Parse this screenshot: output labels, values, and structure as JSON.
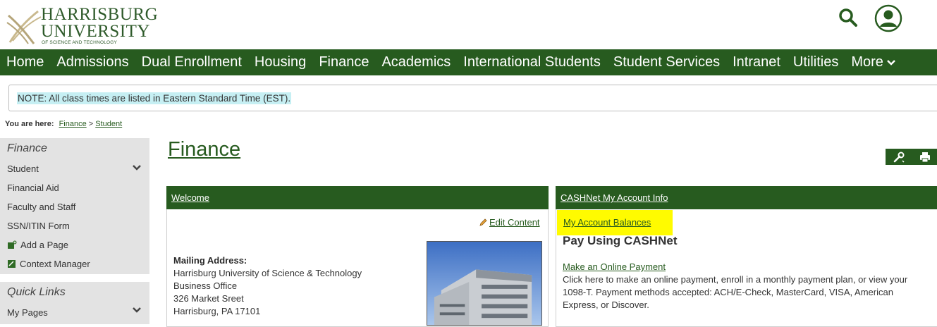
{
  "logo": {
    "line1": "HARRISBURG",
    "line2": "UNIVERSITY",
    "line3": "OF SCIENCE AND TECHNOLOGY"
  },
  "header": {
    "search_icon": "search-icon",
    "user_icon": "user-account-icon"
  },
  "nav": {
    "items": [
      "Home",
      "Admissions",
      "Dual Enrollment",
      "Housing",
      "Finance",
      "Academics",
      "International Students",
      "Student Services",
      "Intranet",
      "Utilities"
    ],
    "more_label": "More"
  },
  "note": {
    "text": "NOTE: All class times are listed in Eastern Standard Time (EST)."
  },
  "breadcrumb": {
    "label": "You are here:",
    "items": [
      "Finance",
      "Student"
    ],
    "separator": ">"
  },
  "sidebar": {
    "section1_title": "Finance",
    "items": [
      "Student",
      "Financial Aid",
      "Faculty and Staff",
      "SSN/ITIN Form"
    ],
    "add_page": "Add a Page",
    "context_manager": "Context Manager",
    "section2_title": "Quick Links",
    "section2_items": [
      "My Pages"
    ]
  },
  "main": {
    "title": "Finance"
  },
  "welcome_panel": {
    "title": "Welcome",
    "edit_label": "Edit Content",
    "address_heading": "Mailing Address:",
    "address_lines": [
      "Harrisburg University of Science & Technology",
      "Business Office",
      "326 Market Sreet",
      "Harrisburg, PA 17101"
    ]
  },
  "cashnet_panel": {
    "title": "CASHNet My Account Info",
    "balances_link": "My Account Balances",
    "pay_heading": "Pay Using CASHNet",
    "payment_link": "Make an Online Payment",
    "payment_desc": "Click here to make an online payment, enroll in a monthly payment plan, or view your 1098-T. Payment methods accepted: ACH/E-Check, MasterCard, VISA, American Express, or Discover."
  },
  "colors": {
    "brand_green": "#275b1f",
    "highlight_yellow": "#fffb00",
    "note_highlight": "#c6eff3",
    "sidebar_bg": "#e3e3e3"
  }
}
